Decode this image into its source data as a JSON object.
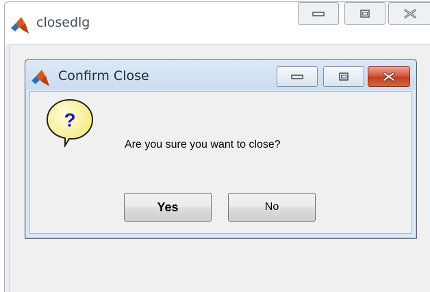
{
  "outer_window": {
    "title": "closedlg",
    "controls": [
      "minimize-icon",
      "maximize-icon",
      "close-icon"
    ]
  },
  "dialog": {
    "title": "Confirm Close",
    "message": "Are you sure you want to close?",
    "icon": "question-icon",
    "icon_glyph": "?",
    "controls": [
      "minimize-icon",
      "maximize-icon",
      "close-icon"
    ],
    "buttons": {
      "yes": "Yes",
      "no": "No"
    }
  },
  "colors": {
    "question_bubble": "#fff9a8",
    "question_mark": "#1a1aa8",
    "close_button": "#c7452a"
  }
}
